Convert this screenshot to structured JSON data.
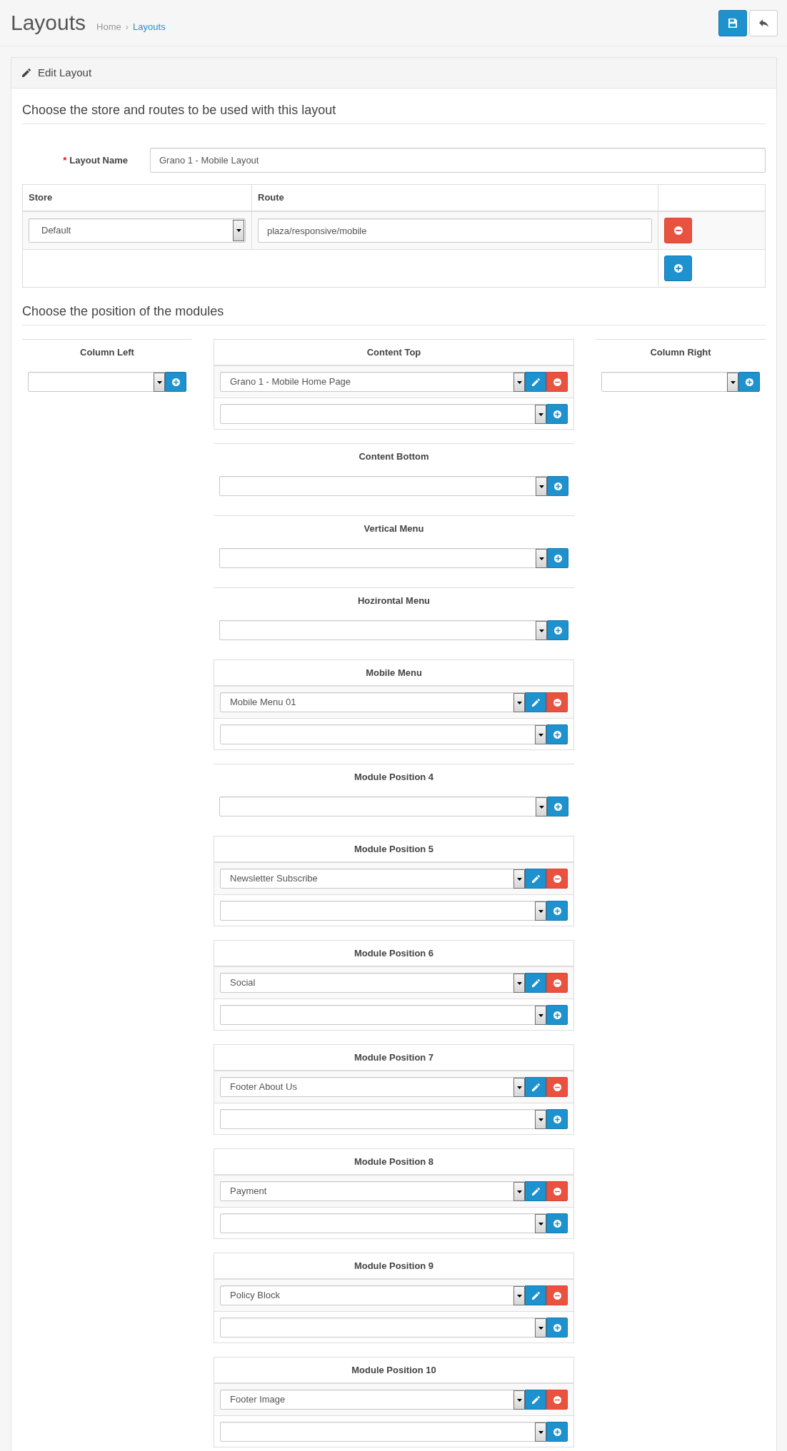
{
  "page_header": {
    "title": "Layouts",
    "breadcrumb": {
      "items": [
        {
          "label": "Home",
          "current": false
        },
        {
          "label": "Layouts",
          "current": true
        }
      ],
      "separator": "›"
    },
    "buttons": [
      {
        "kind": "save"
      },
      {
        "kind": "back"
      }
    ]
  },
  "panel": {
    "title": "Edit Layout"
  },
  "store_routes": {
    "legend": "Choose the store and routes to be used with this layout",
    "layout_name": {
      "required_mark": "*",
      "label": "Layout Name",
      "value": "Grano 1 - Mobile Layout"
    },
    "table": {
      "columns": [
        "Store",
        "Route"
      ],
      "rows": [
        {
          "store": "Default",
          "route": "plaza/responsive/mobile"
        }
      ]
    }
  },
  "module_positions": {
    "legend": "Choose the position of the modules",
    "columns": [
      {
        "positions": [
          {
            "heading": "Column Left"
          }
        ]
      },
      {
        "positions": [
          {
            "heading": "Content Top",
            "modules": [
              "Grano 1 - Mobile Home Page"
            ]
          },
          {
            "heading": "Content Bottom"
          },
          {
            "heading": "Vertical Menu"
          },
          {
            "heading": "Hozirontal Menu"
          },
          {
            "heading": "Mobile Menu",
            "modules": [
              "Mobile Menu 01"
            ]
          },
          {
            "heading": "Module Position 4"
          },
          {
            "heading": "Module Position 5",
            "modules": [
              "Newsletter Subscribe"
            ]
          },
          {
            "heading": "Module Position 6",
            "modules": [
              "Social"
            ]
          },
          {
            "heading": "Module Position 7",
            "modules": [
              "Footer About Us"
            ]
          },
          {
            "heading": "Module Position 8",
            "modules": [
              "Payment"
            ]
          },
          {
            "heading": "Module Position 9",
            "modules": [
              "Policy Block"
            ]
          },
          {
            "heading": "Module Position 10",
            "modules": [
              "Footer Image"
            ]
          }
        ]
      },
      {
        "positions": [
          {
            "heading": "Column Right"
          }
        ]
      }
    ]
  }
}
